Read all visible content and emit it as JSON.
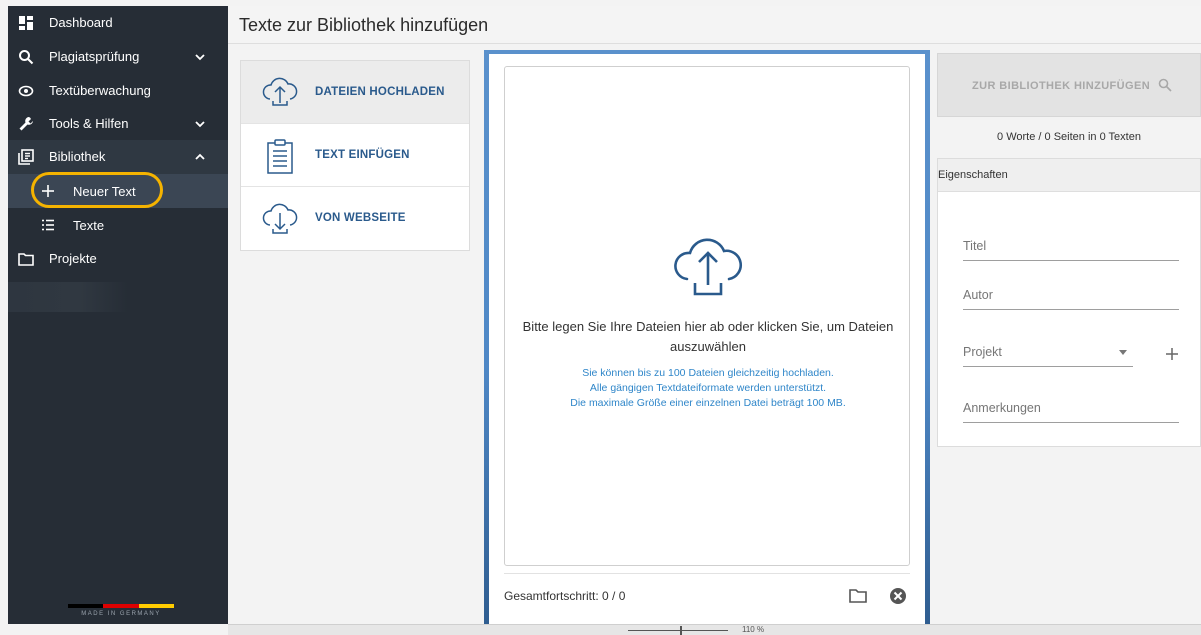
{
  "sidebar": {
    "items": [
      {
        "label": "Dashboard",
        "icon": "dashboard-icon"
      },
      {
        "label": "Plagiatsprüfung",
        "icon": "search-icon"
      },
      {
        "label": "Textüberwachung",
        "icon": "eye-icon"
      },
      {
        "label": "Tools & Hilfen",
        "icon": "wrench-icon"
      },
      {
        "label": "Bibliothek",
        "icon": "library-icon"
      },
      {
        "label": "Projekte",
        "icon": "folder-icon"
      }
    ],
    "sub_items": [
      {
        "label": "Neuer Text",
        "icon": "plus-icon"
      },
      {
        "label": "Texte",
        "icon": "list-icon"
      }
    ],
    "footer_text": "MADE IN GERMANY",
    "flag_colors": [
      "#000000",
      "#dd0000",
      "#ffcc00"
    ],
    "highlight_color": "#f5b300"
  },
  "header": {
    "title": "Texte zur Bibliothek hinzufügen"
  },
  "source_tabs": [
    {
      "label": "DATEIEN HOCHLADEN",
      "icon": "cloud-upload-icon"
    },
    {
      "label": "TEXT EINFÜGEN",
      "icon": "clipboard-icon"
    },
    {
      "label": "VON WEBSEITE",
      "icon": "cloud-download-icon"
    }
  ],
  "dropzone": {
    "main_text": "Bitte legen Sie Ihre Dateien hier ab oder klicken Sie, um Dateien auszuwählen",
    "hints": [
      "Sie können bis zu 100 Dateien gleichzeitig hochladen.",
      "Alle gängigen Textdateiformate werden unterstützt.",
      "Die maximale Größe einer einzelnen Datei beträgt 100 MB."
    ],
    "progress_label": "Gesamtfortschritt: 0 / 0"
  },
  "right_panel": {
    "add_button": "ZUR BIBLIOTHEK HINZUFÜGEN",
    "stats": "0 Worte / 0 Seiten in 0 Texten",
    "properties_title": "Eigenschaften",
    "fields": {
      "title_placeholder": "Titel",
      "author_placeholder": "Autor",
      "project_placeholder": "Projekt",
      "notes_placeholder": "Anmerkungen"
    }
  },
  "status_bar": {
    "zoom": "110 %"
  },
  "colors": {
    "accent_blue": "#2a5a8c",
    "hint_blue": "#2f86c9",
    "sidebar_bg": "#262d36"
  }
}
